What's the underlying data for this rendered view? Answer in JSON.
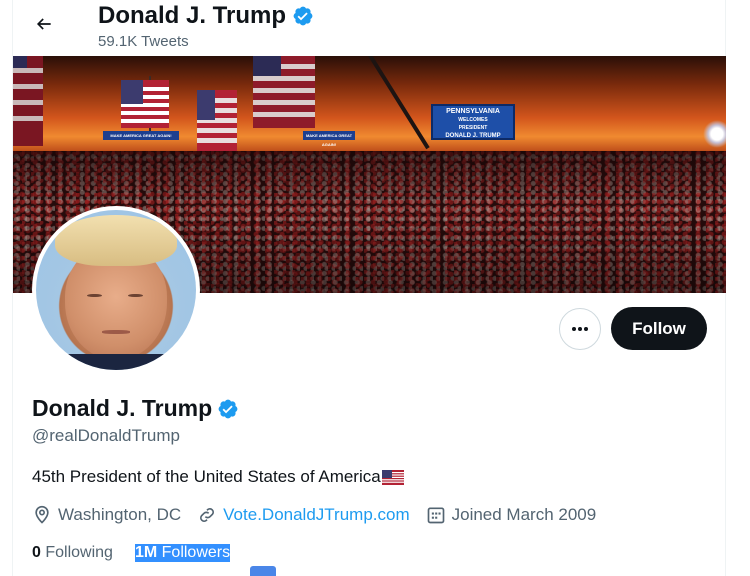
{
  "header": {
    "name": "Donald J. Trump",
    "tweet_count": "59.1K Tweets"
  },
  "banner": {
    "stage_sign_lines": [
      "PENNSYLVANIA",
      "WELCOMES",
      "PRESIDENT",
      "DONALD J. TRUMP"
    ],
    "rail_sign": "MAKE AMERICA GREAT AGAIN!"
  },
  "actions": {
    "more_label": "•••",
    "follow_label": "Follow"
  },
  "profile": {
    "name": "Donald J. Trump",
    "handle": "@realDonaldTrump",
    "bio": "45th President of the United States of America",
    "location": "Washington, DC",
    "website": "Vote.DonaldJTrump.com",
    "joined": "Joined March 2009"
  },
  "stats": {
    "following_count": "0",
    "following_label": "Following",
    "followers_count": "1M",
    "followers_label": "Followers"
  },
  "colors": {
    "accent": "#1d9bf0",
    "text": "#0f1419",
    "muted": "#536471",
    "verified": "#1d9bf0",
    "follow_bg": "#0f1419"
  },
  "icons": [
    "back-arrow-icon",
    "verified-badge-icon",
    "more-dots-icon",
    "location-pin-icon",
    "link-icon",
    "calendar-icon",
    "us-flag-emoji"
  ]
}
